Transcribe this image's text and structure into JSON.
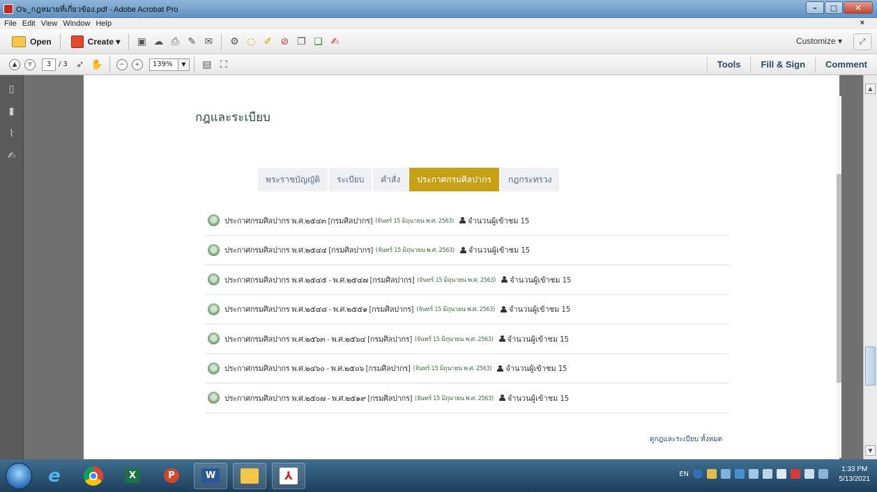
{
  "window": {
    "title": "O๖_กฎหมายที่เกี่ยวข้อง.pdf - Adobe Acrobat Pro"
  },
  "menu": [
    "File",
    "Edit",
    "View",
    "Window",
    "Help"
  ],
  "toolbar": {
    "open_label": "Open",
    "create_label": "Create ▾",
    "customize_label": "Customize ▾"
  },
  "nav": {
    "page_current": "3",
    "page_total": "/ 3",
    "zoom": "139%"
  },
  "right_tabs": [
    "Tools",
    "Fill & Sign",
    "Comment"
  ],
  "page": {
    "section_title": "กฎและระเบียบ",
    "tabs": [
      {
        "label": "พระราชบัญญัติ",
        "active": false
      },
      {
        "label": "ระเบียบ",
        "active": false
      },
      {
        "label": "คำสั่ง",
        "active": false
      },
      {
        "label": "ประกาศกรมศิลปากร",
        "active": true
      },
      {
        "label": "กฎกระทรวง",
        "active": false
      }
    ],
    "items": [
      {
        "title": "ประกาศกรมศิลปากร พ.ศ.๒๕๔๓ [กรมศิลปากร]",
        "date": "(จันทร์ 15 มิถุนายน พ.ศ. 2563)",
        "views": "จำนวนผู้เข้าชม 15"
      },
      {
        "title": "ประกาศกรมศิลปากร พ.ศ.๒๕๔๔ [กรมศิลปากร]",
        "date": "(จันทร์ 15 มิถุนายน พ.ศ. 2563)",
        "views": "จำนวนผู้เข้าชม 15"
      },
      {
        "title": "ประกาศกรมศิลปากร พ.ศ.๒๕๔๕ - พ.ศ.๒๕๔๗ [กรมศิลปากร]",
        "date": "(จันทร์ 15 มิถุนายน พ.ศ. 2563)",
        "views": "จำนวนผู้เข้าชม 15"
      },
      {
        "title": "ประกาศกรมศิลปากร พ.ศ.๒๕๔๘ - พ.ศ.๒๕๕๑ [กรมศิลปากร]",
        "date": "(จันทร์ 15 มิถุนายน พ.ศ. 2563)",
        "views": "จำนวนผู้เข้าชม 15"
      },
      {
        "title": "ประกาศกรมศิลปากร พ.ศ.๒๕๖๓ - พ.ศ.๒๕๖๔ [กรมศิลปากร]",
        "date": "(จันทร์ 15 มิถุนายน พ.ศ. 2563)",
        "views": "จำนวนผู้เข้าชม 15"
      },
      {
        "title": "ประกาศกรมศิลปากร พ.ศ.๒๔๖๐ - พ.ศ.๒๕๐๖ [กรมศิลปากร]",
        "date": "(จันทร์ 15 มิถุนายน พ.ศ. 2563)",
        "views": "จำนวนผู้เข้าชม 15"
      },
      {
        "title": "ประกาศกรมศิลปากร พ.ศ.๒๕๐๗ - พ.ศ.๒๕๑๙ [กรมศิลปากร]",
        "date": "(จันทร์ 15 มิถุนายน พ.ศ. 2563)",
        "views": "จำนวนผู้เข้าชม 15"
      }
    ],
    "view_all": "ดูกฎและระเบียบ ทั้งหมด"
  },
  "tray": {
    "lang": "EN",
    "time": "1:33 PM",
    "date": "5/13/2021"
  },
  "colors": {
    "active_tab": "#c6a116",
    "accent_green": "#3f6e3f"
  }
}
